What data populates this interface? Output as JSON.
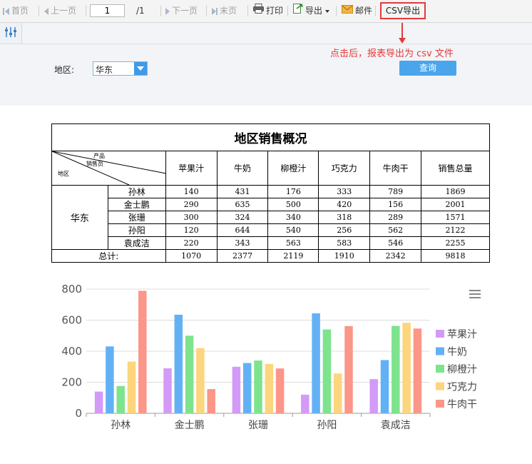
{
  "toolbar": {
    "first": "首页",
    "prev": "上一页",
    "page_value": "1",
    "page_total": "/1",
    "next": "下一页",
    "last": "末页",
    "print": "打印",
    "export": "导出",
    "mail": "邮件",
    "csv_export": "CSV导出"
  },
  "params": {
    "region_label": "地区:",
    "region_value": "华东",
    "query_label": "查询",
    "note": "点击后，报表导出为 csv 文件"
  },
  "report": {
    "title": "地区销售概况",
    "corner": {
      "product": "产品",
      "salesperson": "销售员",
      "region": "地区"
    },
    "columns": [
      "苹果汁",
      "牛奶",
      "柳橙汁",
      "巧克力",
      "牛肉干",
      "销售总量"
    ],
    "region": "华东",
    "rows": [
      {
        "name": "孙林",
        "values": [
          "140",
          "431",
          "176",
          "333",
          "789",
          "1869"
        ]
      },
      {
        "name": "金士鹏",
        "values": [
          "290",
          "635",
          "500",
          "420",
          "156",
          "2001"
        ]
      },
      {
        "name": "张珊",
        "values": [
          "300",
          "324",
          "340",
          "318",
          "289",
          "1571"
        ]
      },
      {
        "name": "孙阳",
        "values": [
          "120",
          "644",
          "540",
          "256",
          "562",
          "2122"
        ]
      },
      {
        "name": "袁成洁",
        "values": [
          "220",
          "343",
          "563",
          "583",
          "546",
          "2255"
        ]
      }
    ],
    "total_label": "总计:",
    "totals": [
      "1070",
      "2377",
      "2119",
      "1910",
      "2342",
      "9818"
    ]
  },
  "chart_data": {
    "type": "bar",
    "categories": [
      "孙林",
      "金士鹏",
      "张珊",
      "孙阳",
      "袁成洁"
    ],
    "series": [
      {
        "name": "苹果汁",
        "color": "#d49af7",
        "values": [
          140,
          290,
          300,
          120,
          220
        ]
      },
      {
        "name": "牛奶",
        "color": "#63b1f5",
        "values": [
          431,
          635,
          324,
          644,
          343
        ]
      },
      {
        "name": "柳橙汁",
        "color": "#7de38d",
        "values": [
          176,
          500,
          340,
          540,
          563
        ]
      },
      {
        "name": "巧克力",
        "color": "#fcd57c",
        "values": [
          333,
          420,
          318,
          256,
          583
        ]
      },
      {
        "name": "牛肉干",
        "color": "#fb9688",
        "values": [
          789,
          156,
          289,
          562,
          546
        ]
      }
    ],
    "ylim": [
      0,
      800
    ],
    "yticks": [
      0,
      200,
      400,
      600,
      800
    ],
    "grid": true,
    "legend": "right"
  }
}
